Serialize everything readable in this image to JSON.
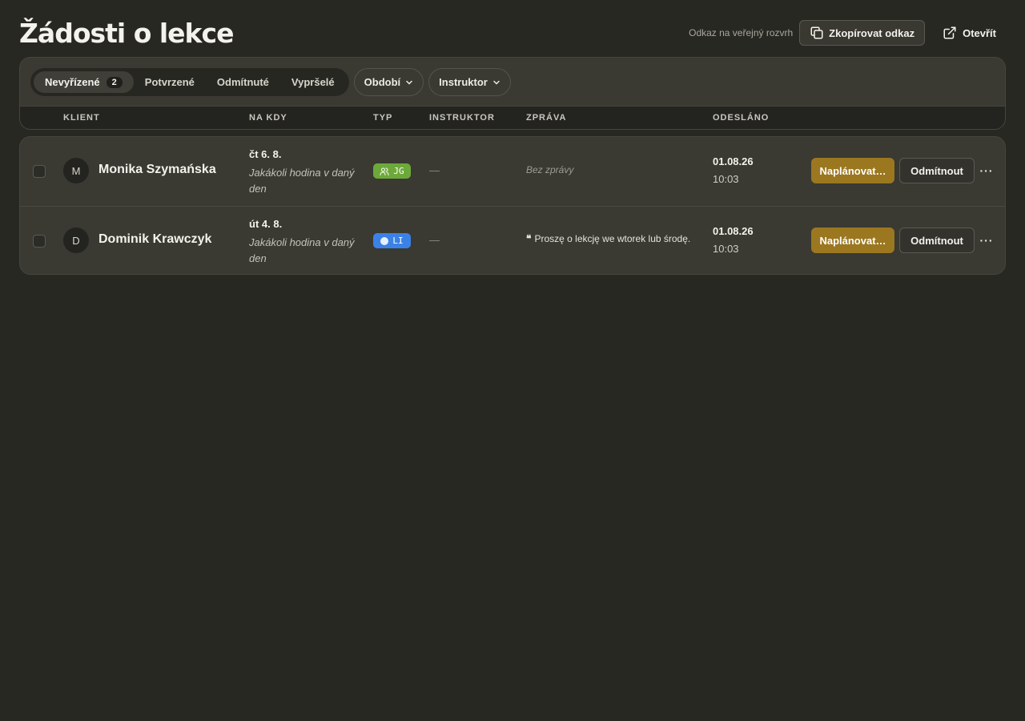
{
  "header": {
    "title": "Žádosti o lekce",
    "public_link_label": "Odkaz na veřejný rozvrh",
    "copy_label": "Zkopírovat odkaz",
    "open_label": "Otevřít"
  },
  "filters": {
    "tabs": [
      {
        "label": "Nevyřízené",
        "badge": "2",
        "active": true
      },
      {
        "label": "Potvrzené"
      },
      {
        "label": "Odmítnuté"
      },
      {
        "label": "Vypršelé"
      }
    ],
    "period_label": "Období",
    "instructor_label": "Instruktor"
  },
  "columns": {
    "client": "KLIENT",
    "when": "NA KDY",
    "type": "TYP",
    "instructor": "INSTRUKTOR",
    "message": "ZPRÁVA",
    "sent": "ODESLÁNO"
  },
  "rows": [
    {
      "avatar": "M",
      "name": "Monika Szymańska",
      "date": "čt 6. 8.",
      "note": "Jakákoli hodina v daný den",
      "type": "JG",
      "type_color": "#6da93a",
      "instructor": "—",
      "message": "Bez zprávy",
      "sent_date": "01.08.26",
      "sent_time": "10:03",
      "schedule_label": "Naplánovat…",
      "reject_label": "Odmítnout",
      "more_label": "···"
    },
    {
      "avatar": "D",
      "name": "Dominik Krawczyk",
      "date": "út 4. 8.",
      "note": "Jakákoli hodina v daný den",
      "type": "LI",
      "type_color": "#3b82e6",
      "instructor": "—",
      "quote": "❝",
      "message": "Proszę o lekcję we wtorek lub środę.",
      "sent_date": "01.08.26",
      "sent_time": "10:03",
      "schedule_label": "Naplánovat…",
      "reject_label": "Odmítnout",
      "more_label": "···"
    }
  ],
  "colors": {
    "background": "#282823",
    "panel": "#3a3932",
    "accent": "#9b7720"
  }
}
